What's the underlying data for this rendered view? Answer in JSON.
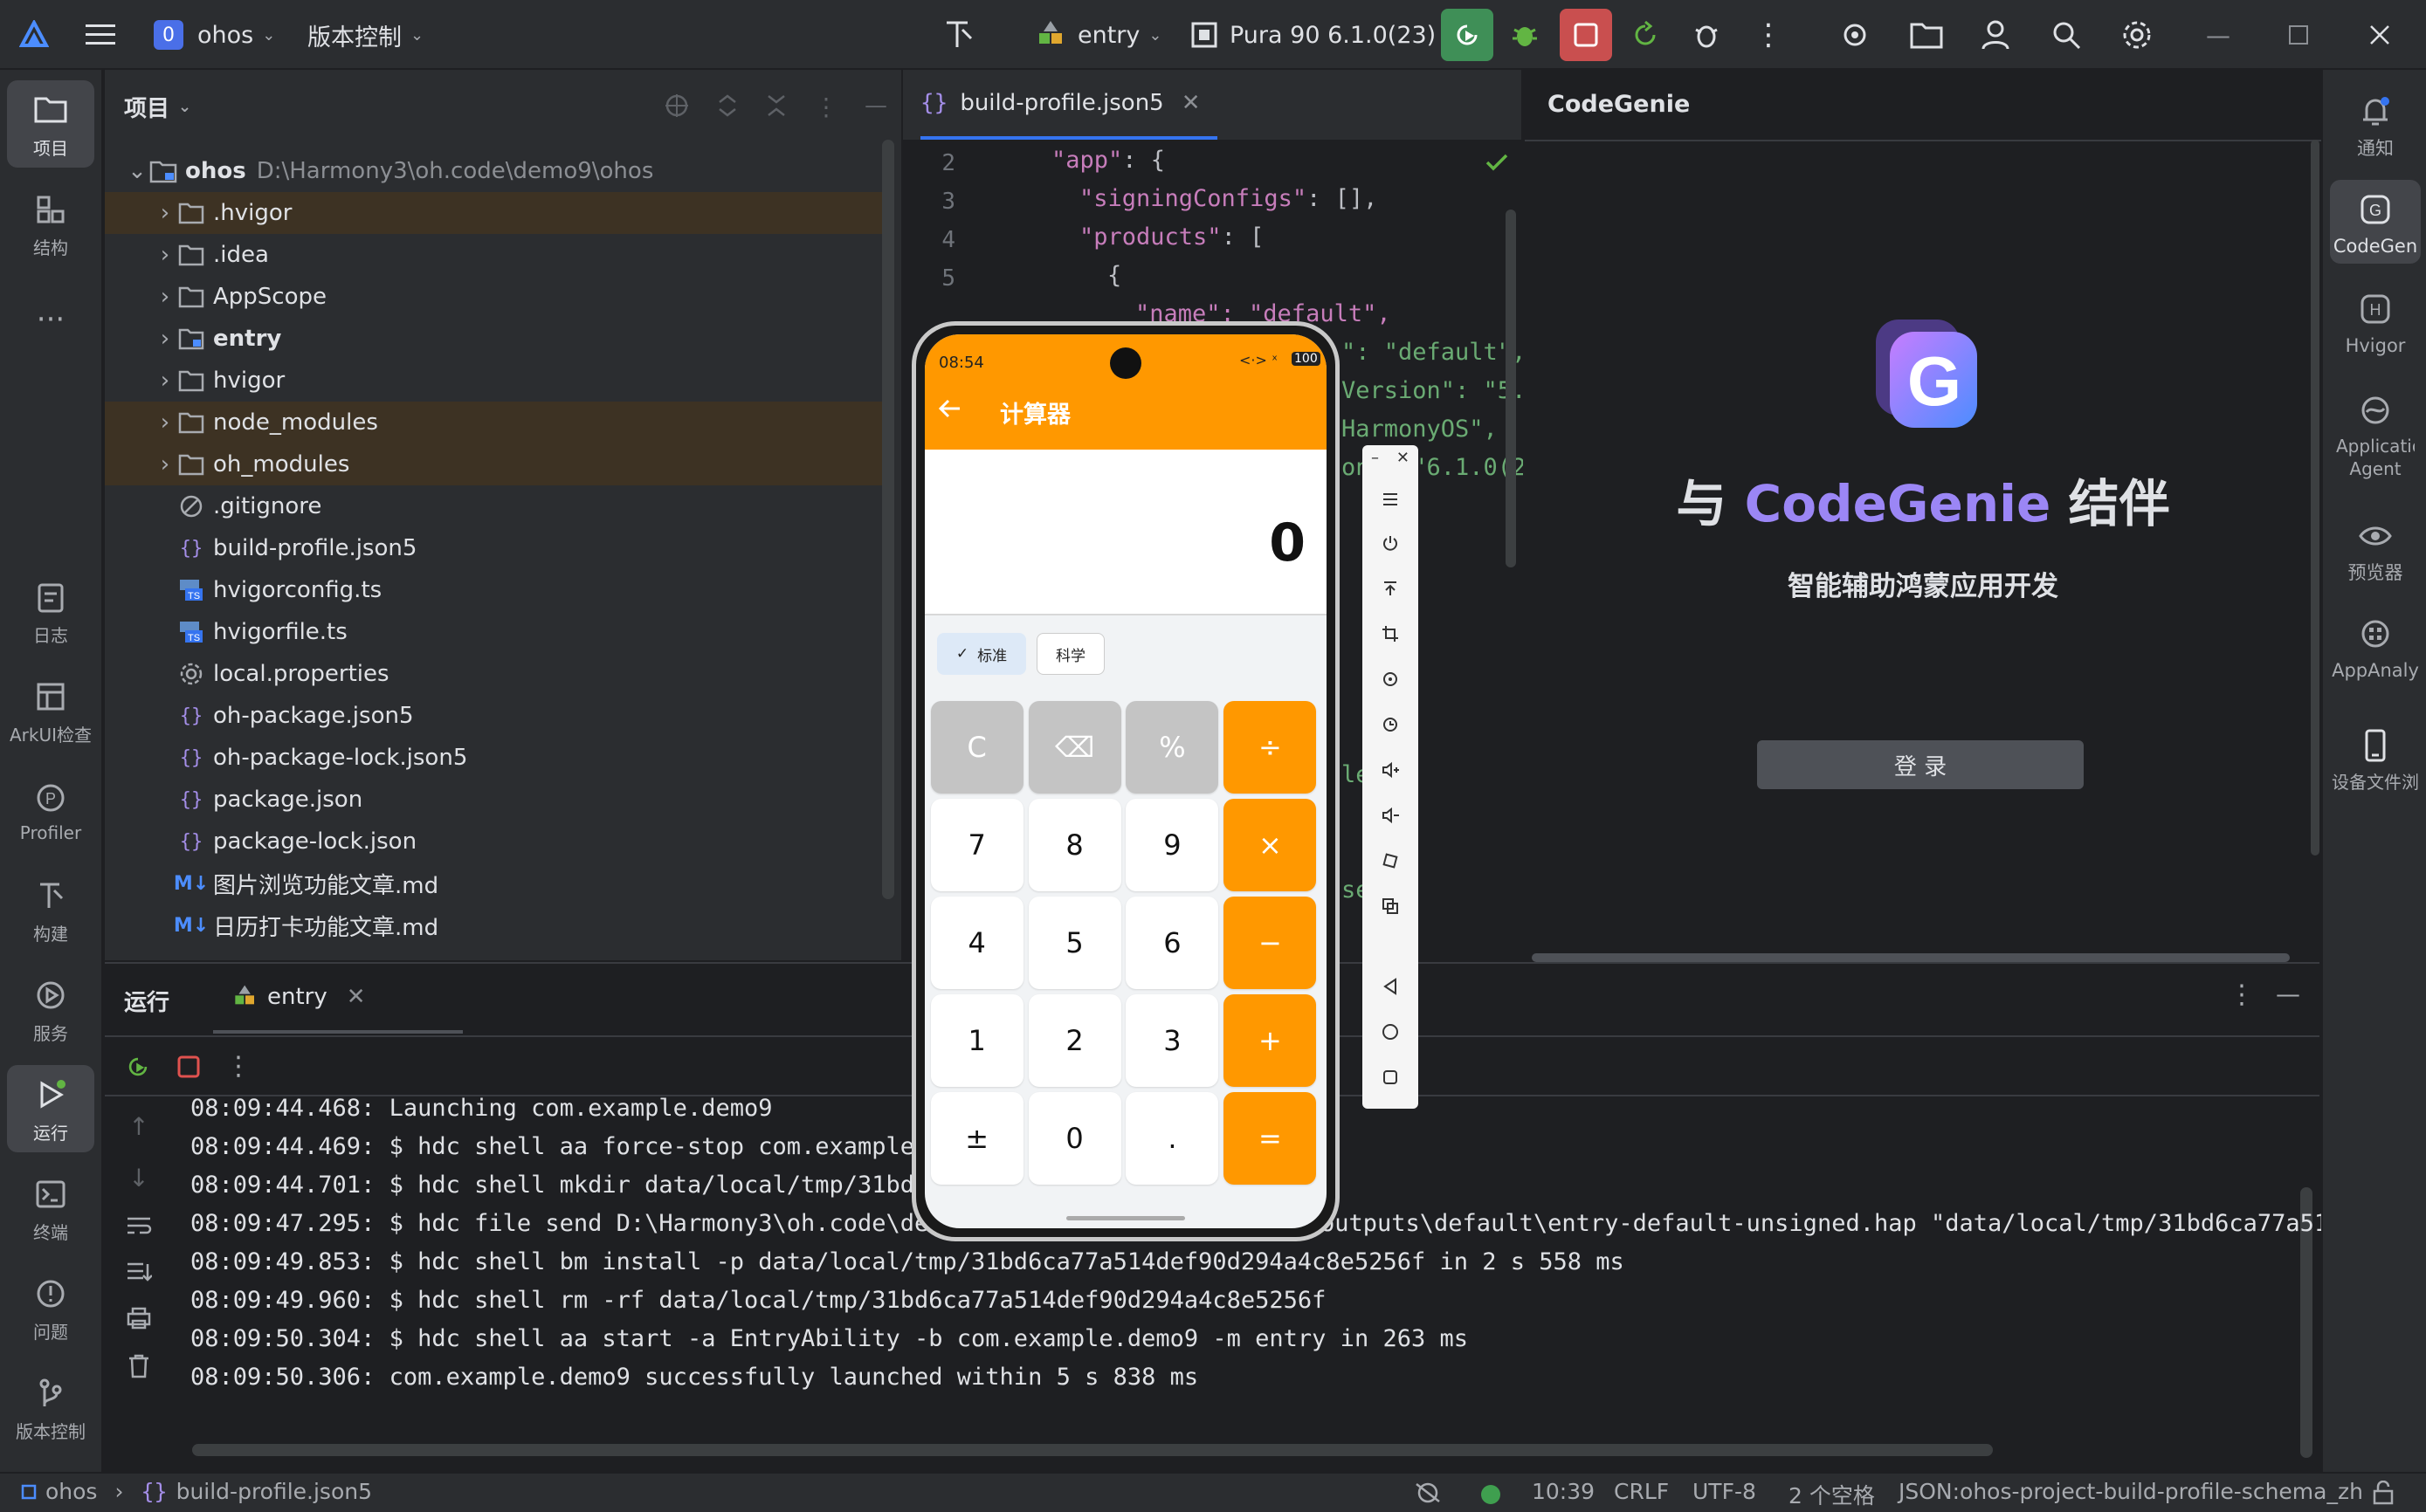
{
  "titlebar": {
    "project_badge": "0",
    "project": "ohos",
    "vcs": "版本控制",
    "run_config": "entry",
    "device": "Pura 90 6.1.0(23)"
  },
  "left_tools": [
    {
      "label": "项目"
    },
    {
      "label": "结构"
    },
    {
      "label": "日志"
    },
    {
      "label": "ArkUI检查"
    },
    {
      "label": "Profiler"
    },
    {
      "label": "构建"
    },
    {
      "label": "服务"
    },
    {
      "label": "运行"
    },
    {
      "label": "终端"
    },
    {
      "label": "问题"
    },
    {
      "label": "版本控制"
    }
  ],
  "right_tools": [
    {
      "label": "通知"
    },
    {
      "label": "CodeGen"
    },
    {
      "label": "Hvigor"
    },
    {
      "label": "Applicatio Agent"
    },
    {
      "label": "预览器"
    },
    {
      "label": "AppAnaly"
    },
    {
      "label": "设备文件浏"
    }
  ],
  "project_panel": {
    "title": "项目",
    "root_name": "ohos",
    "root_path": "D:\\Harmony3\\oh.code\\demo9\\ohos",
    "items": [
      {
        "name": ".hvigor",
        "type": "folder",
        "highlight": true
      },
      {
        "name": ".idea",
        "type": "folder",
        "highlight": false
      },
      {
        "name": "AppScope",
        "type": "folder",
        "highlight": false
      },
      {
        "name": "entry",
        "type": "module",
        "highlight": false
      },
      {
        "name": "hvigor",
        "type": "folder",
        "highlight": false
      },
      {
        "name": "node_modules",
        "type": "folder",
        "highlight": true
      },
      {
        "name": "oh_modules",
        "type": "folder",
        "highlight": true
      },
      {
        "name": ".gitignore",
        "type": "ignore"
      },
      {
        "name": "build-profile.json5",
        "type": "json"
      },
      {
        "name": "hvigorconfig.ts",
        "type": "ts"
      },
      {
        "name": "hvigorfile.ts",
        "type": "ts"
      },
      {
        "name": "local.properties",
        "type": "props"
      },
      {
        "name": "oh-package.json5",
        "type": "json"
      },
      {
        "name": "oh-package-lock.json5",
        "type": "json"
      },
      {
        "name": "package.json",
        "type": "json"
      },
      {
        "name": "package-lock.json",
        "type": "json"
      },
      {
        "name": "图片浏览功能文章.md",
        "type": "md"
      },
      {
        "name": "日历打卡功能文章.md",
        "type": "md"
      }
    ]
  },
  "editor": {
    "tab": "build-profile.json5",
    "line_numbers": [
      "2",
      "3",
      "4",
      "5"
    ],
    "code": {
      "l1": "\"app\"",
      "l1b": ": {",
      "l2": "\"signingConfigs\"",
      "l2b": ": [],",
      "l3": "\"products\"",
      "l3b": ": [",
      "l4": "{",
      "l5": "\"name\": \"default\",",
      "l6": "\": \"default\",",
      "l7": "Version\": \"5.0",
      "l8": "HarmonyOS\",",
      "l9": "on\": \"6.1.0(2",
      "l10": "le",
      "l11": "se"
    }
  },
  "codegenie": {
    "title": "CodeGenie",
    "headline_prefix": "与",
    "headline_brand": "CodeGenie",
    "headline_suffix": "结伴",
    "subtitle": "智能辅助鸿蒙应用开发",
    "login": "登 录"
  },
  "run_panel": {
    "title": "运行",
    "tab": "entry",
    "logs": [
      "08:09:44.468: Launching com.example.demo9",
      "08:09:44.469: $ hdc shell aa force-stop com.example.",
      "08:09:44.701: $ hdc shell mkdir data/local/tmp/31bd",
      "08:09:47.295: $ hdc file send D:\\Harmony3\\oh.code\\de",
      "08:09:49.853: $ hdc shell bm install -p data/local/tmp/31bd6ca77a514def90d294a4c8e5256f in 2 s 558 ms",
      "08:09:49.960: $ hdc shell rm -rf data/local/tmp/31bd6ca77a514def90d294a4c8e5256f",
      "08:09:50.304: $ hdc shell aa start -a EntryAbility -b com.example.demo9 -m entry in 263 ms",
      "08:09:50.306: com.example.demo9 successfully launched within 5 s 838 ms"
    ],
    "log3_tail": "outputs\\default\\entry-default-unsigned.hap \"data/local/tmp/31bd6ca77a514"
  },
  "statusbar": {
    "project": "ohos",
    "file": "build-profile.json5",
    "position": "10:39",
    "line_sep": "CRLF",
    "encoding": "UTF-8",
    "indent": "2 个空格",
    "schema": "JSON:ohos-project-build-profile-schema_zh"
  },
  "phone": {
    "time": "08:54",
    "battery": "100",
    "app_title": "计算器",
    "display": "0",
    "mode_standard": "标准",
    "mode_science": "科学",
    "keys": [
      [
        "C",
        "⌫",
        "%",
        "÷"
      ],
      [
        "7",
        "8",
        "9",
        "×"
      ],
      [
        "4",
        "5",
        "6",
        "−"
      ],
      [
        "1",
        "2",
        "3",
        "+"
      ],
      [
        "±",
        "0",
        ".",
        "="
      ]
    ]
  },
  "colors": {
    "accent_orange": "#ff9800",
    "ide_bg": "#1e1f22",
    "panel_bg": "#2b2d30",
    "brand_purple": "#8b7cf6",
    "run_green": "#3f8f57",
    "stop_red": "#c94f4f"
  }
}
